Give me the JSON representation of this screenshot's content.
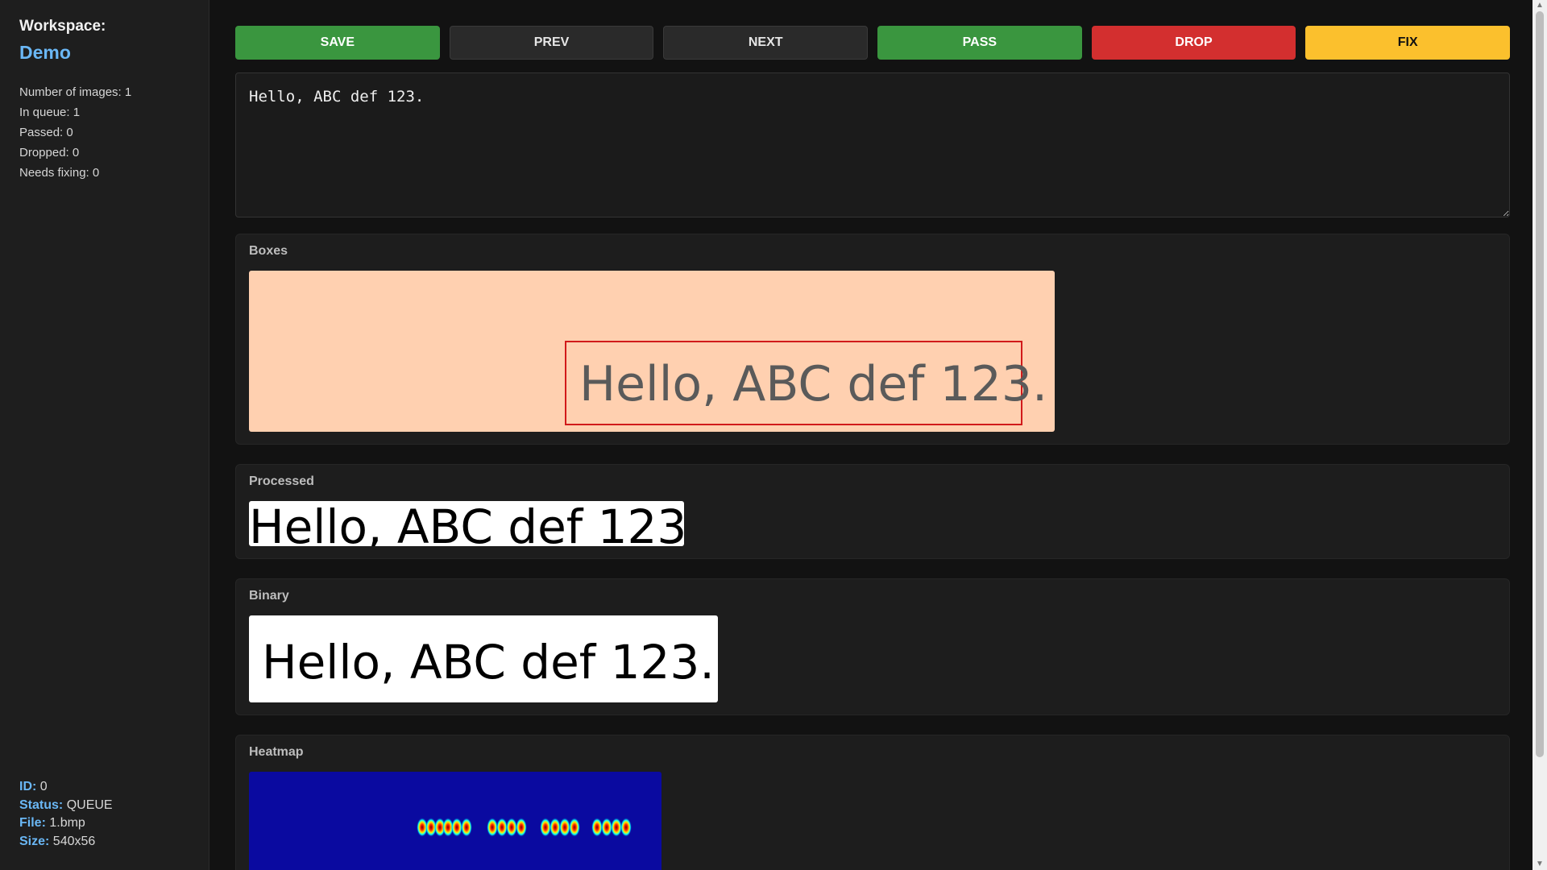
{
  "sidebar": {
    "workspace_label": "Workspace:",
    "workspace_name": "Demo",
    "stats": {
      "num_images": "Number of images: 1",
      "in_queue": "In queue: 1",
      "passed": "Passed: 0",
      "dropped": "Dropped: 0",
      "needs_fixing": "Needs fixing: 0"
    },
    "meta": {
      "id_label": "ID:",
      "id_value": "0",
      "status_label": "Status:",
      "status_value": "QUEUE",
      "file_label": "File:",
      "file_value": "1.bmp",
      "size_label": "Size:",
      "size_value": "540x56"
    }
  },
  "toolbar": {
    "save": "SAVE",
    "prev": "PREV",
    "next": "NEXT",
    "pass": "PASS",
    "drop": "DROP",
    "fix": "FIX"
  },
  "editor": {
    "value": "Hello, ABC def 123."
  },
  "panels": {
    "boxes": {
      "title": "Boxes",
      "image_text": "Hello, ABC def 123."
    },
    "processed": {
      "title": "Processed",
      "image_text": "Hello, ABC def 123."
    },
    "binary": {
      "title": "Binary",
      "image_text": "Hello, ABC def 123."
    },
    "heatmap": {
      "title": "Heatmap"
    }
  },
  "colors": {
    "accent": "#6ab7f5",
    "pass_green": "#3a963f",
    "drop_red": "#d32f2f",
    "fix_yellow": "#fbc02d",
    "boxes_bg": "#ffd0b0",
    "box_outline": "#d11a1a",
    "heatmap_bg": "#0a0aa0"
  },
  "icons": {
    "scroll_up": "triangle-up-icon",
    "scroll_down": "triangle-down-icon"
  }
}
